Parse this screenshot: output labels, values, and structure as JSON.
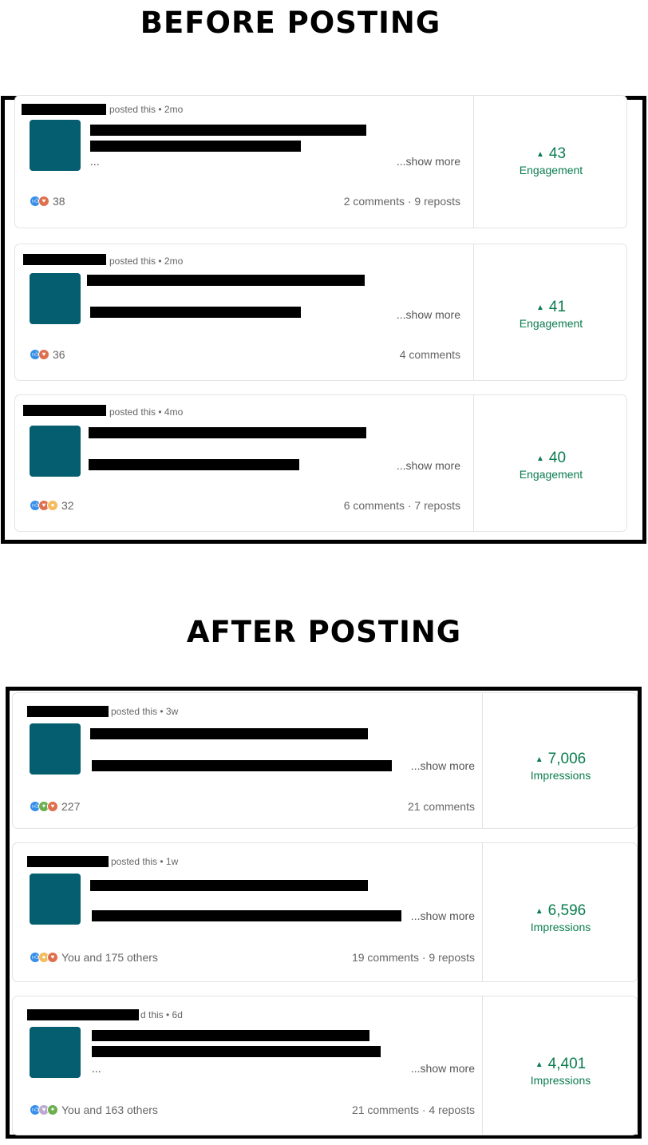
{
  "before": {
    "heading": "BEFORE POSTING",
    "posts": [
      {
        "byline": "posted this • 2mo",
        "snippet_end": "...",
        "show_more": "...show more",
        "reactions": [
          "like",
          "love"
        ],
        "reaction_text": "38",
        "meta": "2 comments · 9 reposts",
        "metric_value": "43",
        "metric_label": "Engagement"
      },
      {
        "byline": "posted this • 2mo",
        "snippet_end": "",
        "show_more": "...show more",
        "reactions": [
          "like",
          "love"
        ],
        "reaction_text": "36",
        "meta": "4 comments",
        "metric_value": "41",
        "metric_label": "Engagement"
      },
      {
        "byline": "posted this • 4mo",
        "snippet_end": "",
        "show_more": "...show more",
        "reactions": [
          "like",
          "love",
          "insight"
        ],
        "reaction_text": "32",
        "meta": "6 comments · 7 reposts",
        "metric_value": "40",
        "metric_label": "Engagement"
      }
    ]
  },
  "after": {
    "heading": "AFTER POSTING",
    "posts": [
      {
        "byline": "posted this • 3w",
        "snippet_end": "",
        "show_more": "...show more",
        "reactions": [
          "like",
          "celebrate",
          "love"
        ],
        "reaction_text": "227",
        "meta": "21 comments",
        "metric_value": "7,006",
        "metric_label": "Impressions"
      },
      {
        "byline": "posted this • 1w",
        "snippet_end": "",
        "show_more": "...show more",
        "reactions": [
          "like",
          "insight",
          "love"
        ],
        "reaction_text": "You and 175 others",
        "meta": "19 comments · 9 reposts",
        "metric_value": "6,596",
        "metric_label": "Impressions"
      },
      {
        "byline": "d this • 6d",
        "snippet_end": "...",
        "show_more": "...show more",
        "reactions": [
          "like",
          "support",
          "celebrate"
        ],
        "reaction_text": "You and 163 others",
        "meta": "21 comments · 4 reposts",
        "metric_value": "4,401",
        "metric_label": "Impressions"
      }
    ]
  },
  "colors": {
    "metric": "#0a7d4f",
    "thumbnail": "#055e6f",
    "like": "#378fe9",
    "love": "#df704d",
    "insight": "#f5bb5c",
    "celebrate": "#6dae4f",
    "support": "#bba9d1"
  }
}
